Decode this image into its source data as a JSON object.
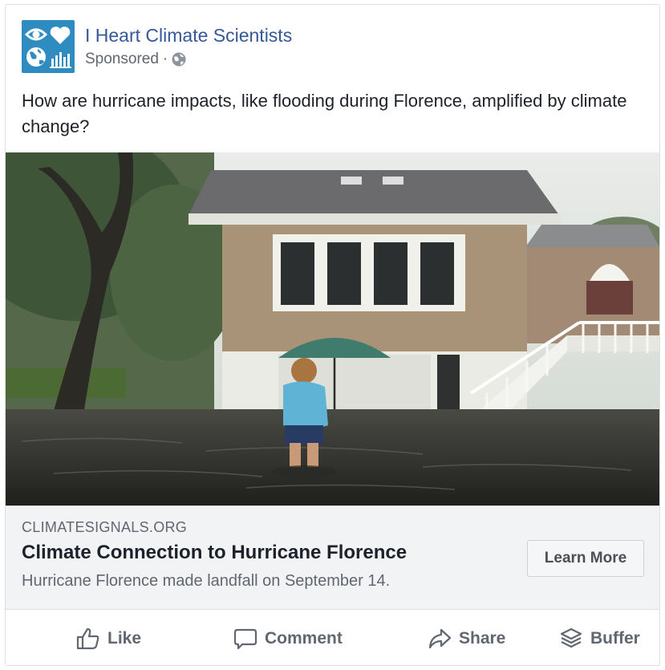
{
  "page": {
    "name": "I Heart Climate Scientists",
    "sponsored_label": "Sponsored",
    "separator": "·",
    "avatar_icon": "eye-heart-globe-chart-logo",
    "privacy_icon": "globe-icon"
  },
  "post": {
    "text": "How are hurricane impacts, like flooding during Florence, amplified by climate change?"
  },
  "photo": {
    "description_icon": "flooded-house-photo"
  },
  "link": {
    "domain": "CLIMATESIGNALS.ORG",
    "title": "Climate Connection to Hurricane Florence",
    "description": "Hurricane Florence made landfall on September 14.",
    "cta_label": "Learn More"
  },
  "actions": {
    "like": "Like",
    "comment": "Comment",
    "share": "Share",
    "buffer": "Buffer"
  },
  "colors": {
    "link_blue": "#365899",
    "avatar_blue": "#2f8cc0",
    "muted_text": "#606770",
    "link_box_bg": "#f2f3f5"
  }
}
